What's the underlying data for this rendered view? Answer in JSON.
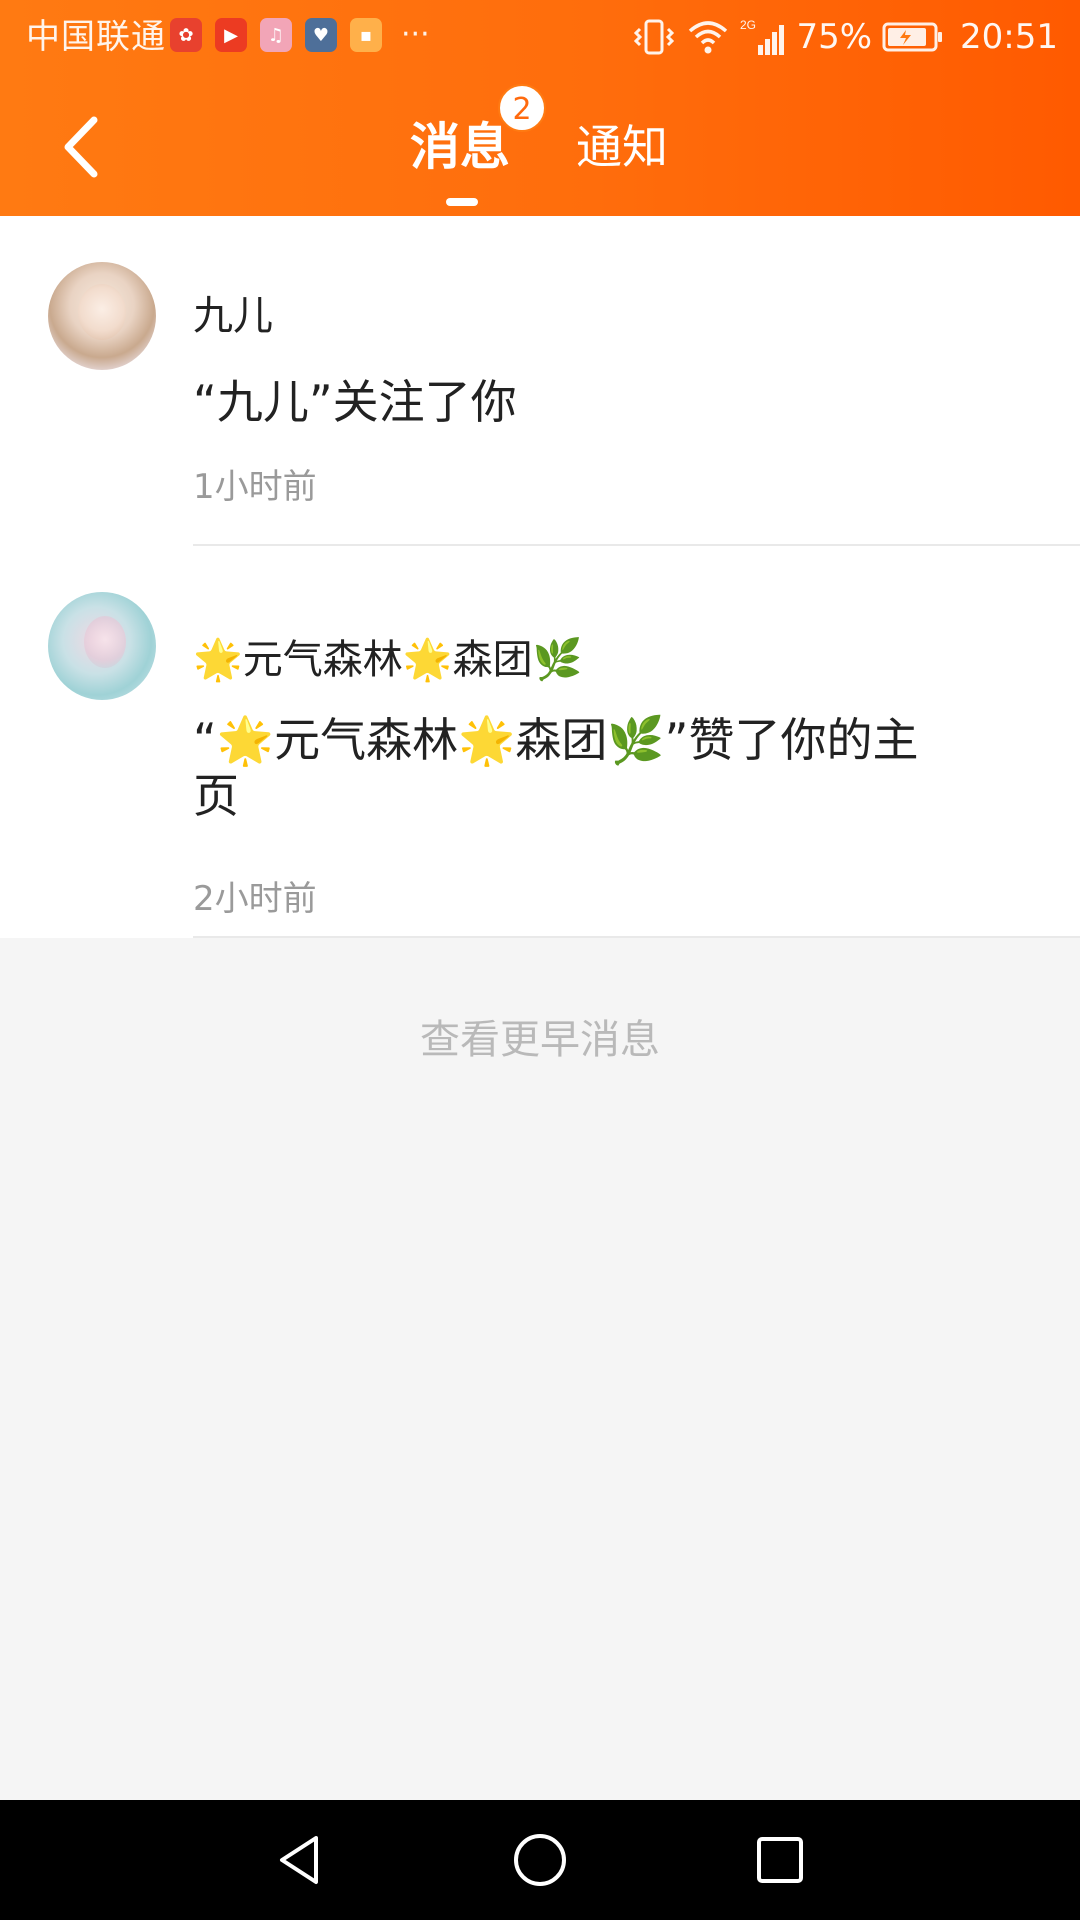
{
  "status_bar": {
    "carrier": "中国联通",
    "battery": "75%",
    "time": "20:51",
    "network_label": "2G",
    "app_icons": [
      "kuaishou-icon",
      "video-icon",
      "music-icon",
      "love-app-icon",
      "notes-icon"
    ],
    "more": "···"
  },
  "header": {
    "tabs": [
      {
        "label": "消息",
        "badge": "2",
        "active": true
      },
      {
        "label": "通知",
        "active": false
      }
    ],
    "accent_start": "#ff7a12",
    "accent_end": "#ff5a00"
  },
  "messages": [
    {
      "avatar": "user-avatar",
      "name": "九儿",
      "content": "“九儿”关注了你",
      "time": "1小时前"
    },
    {
      "avatar": "user-avatar",
      "name": "🌟元气森林🌟森团🌿",
      "content": "“🌟元气森林🌟森团🌿”赞了你的主页",
      "time": "2小时前"
    }
  ],
  "view_earlier": "查看更早消息",
  "system_nav": [
    "back-icon",
    "home-icon",
    "recents-icon"
  ]
}
